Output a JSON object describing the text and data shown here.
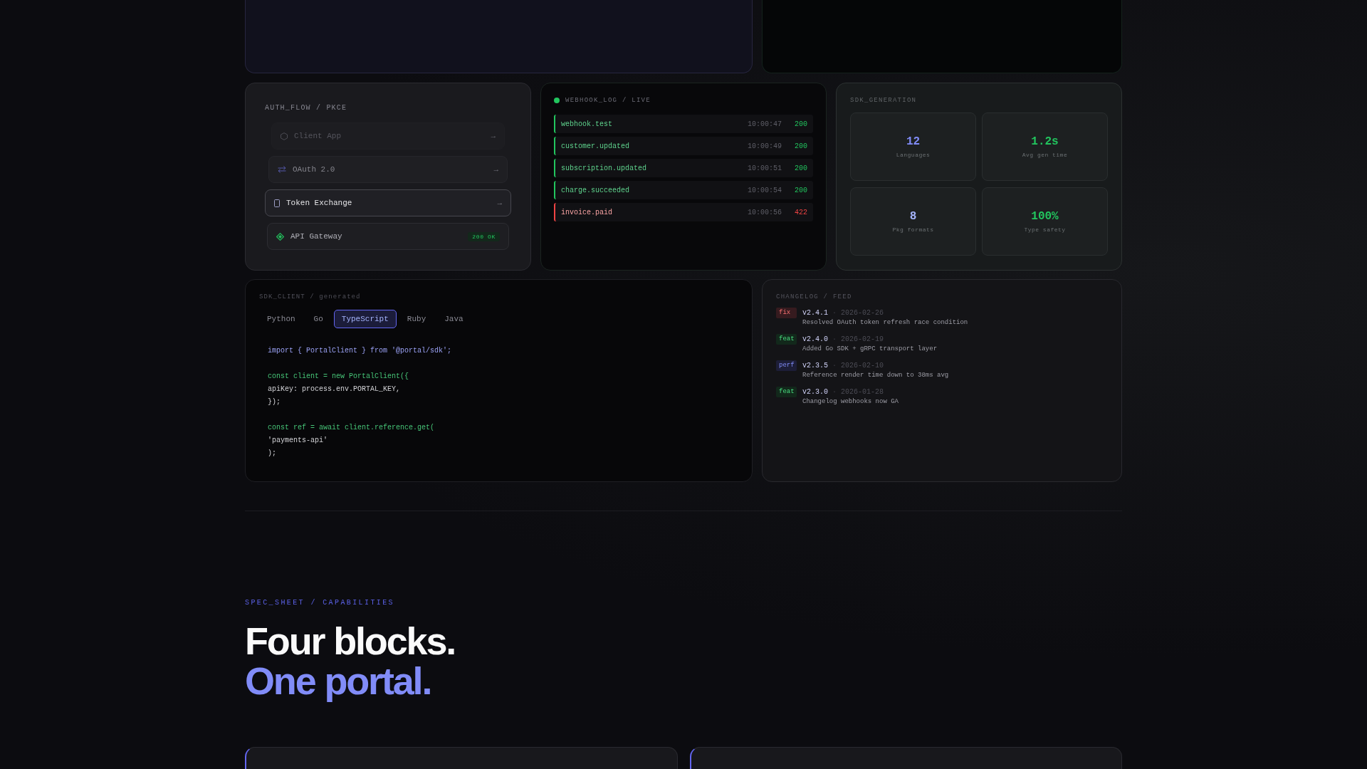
{
  "auth_flow": {
    "title": "AUTH_FLOW / PKCE",
    "steps": [
      {
        "label": "Client App",
        "kind": "faded",
        "arrow": "→"
      },
      {
        "label": "OAuth 2.0",
        "kind": "dim",
        "arrow": "→"
      },
      {
        "label": "Token Exchange",
        "kind": "active",
        "arrow": "→"
      },
      {
        "label": "API Gateway",
        "kind": "done",
        "badge": "200 OK"
      }
    ]
  },
  "webhook_log": {
    "title": "WEBHOOK_LOG / LIVE",
    "live": true,
    "rows": [
      {
        "event": "webhook.test",
        "time": "10:00:47",
        "status": "200",
        "failed": false
      },
      {
        "event": "customer.updated",
        "time": "10:00:49",
        "status": "200",
        "failed": false
      },
      {
        "event": "subscription.updated",
        "time": "10:00:51",
        "status": "200",
        "failed": false
      },
      {
        "event": "charge.succeeded",
        "time": "10:00:54",
        "status": "200",
        "failed": false
      },
      {
        "event": "invoice.paid",
        "time": "10:00:56",
        "status": "422",
        "failed": true
      }
    ]
  },
  "sdk_generation": {
    "title": "SDK_GENERATION",
    "stats": [
      {
        "value": "12",
        "label": "Languages",
        "color": "#818cf8"
      },
      {
        "value": "1.2s",
        "label": "Avg gen time",
        "color": "#22c55e"
      },
      {
        "value": "8",
        "label": "Pkg formats",
        "color": "#a5b4fc"
      },
      {
        "value": "100%",
        "label": "Type safety",
        "color": "#22c55e"
      }
    ]
  },
  "sdk_client": {
    "title": "SDK_CLIENT / generated",
    "tabs": [
      {
        "label": "Python",
        "selected": false
      },
      {
        "label": "Go",
        "selected": false
      },
      {
        "label": "TypeScript",
        "selected": true
      },
      {
        "label": "Ruby",
        "selected": false
      },
      {
        "label": "Java",
        "selected": false
      }
    ],
    "code": [
      {
        "kind": "import",
        "text": "import { PortalClient } from '@portal/sdk';"
      },
      {
        "kind": "blank"
      },
      {
        "kind": "keyword",
        "text": "const client = new PortalClient({"
      },
      {
        "kind": "plain",
        "text": "apiKey: process.env.PORTAL_KEY,"
      },
      {
        "kind": "plain",
        "text": "});"
      },
      {
        "kind": "blank"
      },
      {
        "kind": "keyword",
        "text": "const ref = await client.reference.get("
      },
      {
        "kind": "plain",
        "text": "'payments-api'"
      },
      {
        "kind": "plain",
        "text": ");"
      }
    ]
  },
  "changelog": {
    "title": "CHANGELOG / FEED",
    "entries": [
      {
        "tag": "fix",
        "kind": "fix",
        "version": "v2.4.1",
        "separator": "·",
        "date": "2026-02-26",
        "note": "Resolved OAuth token refresh race condition"
      },
      {
        "tag": "feat",
        "kind": "feat",
        "version": "v2.4.0",
        "separator": "·",
        "date": "2026-02-19",
        "note": "Added Go SDK + gRPC transport layer"
      },
      {
        "tag": "perf",
        "kind": "perf",
        "version": "v2.3.5",
        "separator": "·",
        "date": "2026-02-10",
        "note": "Reference render time down to 38ms avg"
      },
      {
        "tag": "feat",
        "kind": "feat",
        "version": "v2.3.0",
        "separator": "·",
        "date": "2026-01-28",
        "note": "Changelog webhooks now GA"
      }
    ]
  },
  "spec_sheet": {
    "eyebrow": "SPEC_SHEET / CAPABILITIES",
    "headline": "Four blocks.",
    "headline_accent": "One portal."
  }
}
